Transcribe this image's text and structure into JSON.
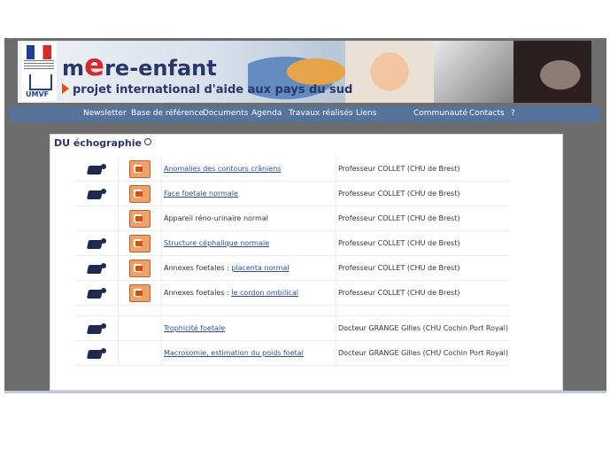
{
  "banner": {
    "title_m": "m",
    "title_e": "e",
    "title_rest": "re-enfant",
    "subtitle": "projet international d'aide aux pays du sud",
    "umvf": "UMVF"
  },
  "nav": {
    "items": [
      "Newsletter",
      "Base de référence",
      "Documents",
      "Agenda",
      "Travaux réalisés",
      "Liens",
      "Communauté",
      "Contacts",
      "?"
    ]
  },
  "panel": {
    "title": "DU échographie"
  },
  "rows": [
    {
      "video": true,
      "ppt": true,
      "prefix": "",
      "link": "Anomalies des contours crâniens",
      "author": "Professeur COLLET (CHU de Brest)"
    },
    {
      "video": true,
      "ppt": true,
      "prefix": "",
      "link": "Face foetale normale",
      "author": "Professeur COLLET (CHU de Brest)"
    },
    {
      "video": false,
      "ppt": true,
      "prefix": "Appareil réno-urinaire normal",
      "link": "",
      "author": "Professeur COLLET (CHU de Brest)"
    },
    {
      "video": true,
      "ppt": true,
      "prefix": "",
      "link": "Structure céphalique normale",
      "author": "Professeur COLLET (CHU de Brest)"
    },
    {
      "video": true,
      "ppt": true,
      "prefix": "Annexes foetales : ",
      "link": "placenta normal",
      "author": "Professeur COLLET (CHU de Brest)"
    },
    {
      "video": true,
      "ppt": true,
      "prefix": "Annexes foetales : ",
      "link": "le cordon ombilical",
      "author": "Professeur COLLET (CHU de Brest)"
    },
    {
      "video": true,
      "ppt": false,
      "prefix": "",
      "link": "Trophicité foetale",
      "author": "Docteur GRANGE Gilles (CHU Cochin Port Royal)"
    },
    {
      "video": true,
      "ppt": false,
      "prefix": "",
      "link": "Macrosomie, estimation du poids foetal",
      "author": "Docteur GRANGE Gilles (CHU Cochin Port Royal)"
    }
  ]
}
